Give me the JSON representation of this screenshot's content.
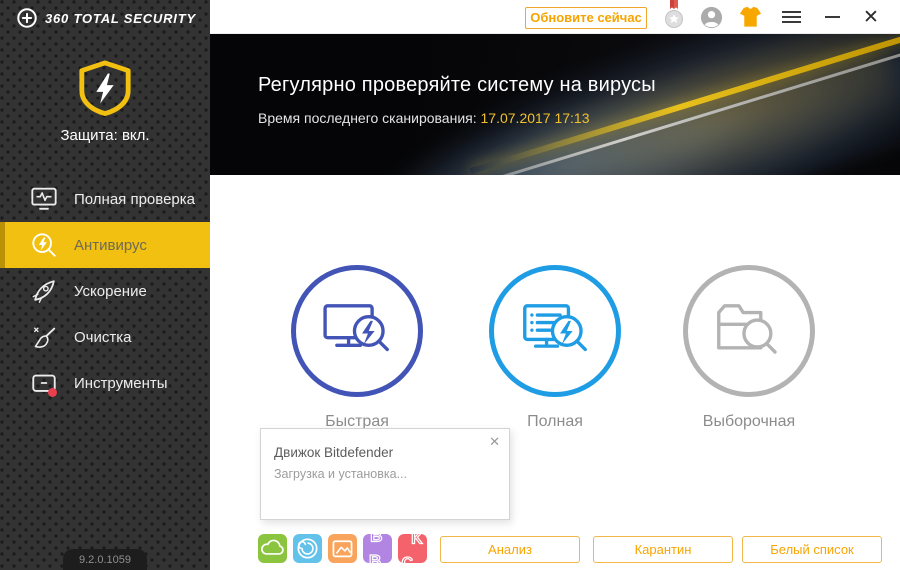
{
  "logo": {
    "text": "360 TOTAL SECURITY"
  },
  "topbar": {
    "update_button": "Обновите сейчас",
    "close_glyph": "✕"
  },
  "sidebar": {
    "protection_status": "Защита: вкл.",
    "items": [
      "Полная проверка",
      "Антивирус",
      "Ускорение",
      "Очистка",
      "Инструменты"
    ],
    "active_item": "Антивирус",
    "version": "9.2.0.1059"
  },
  "banner": {
    "title": "Регулярно проверяйте систему на вирусы",
    "last_scan_label": "Время последнего сканирования:",
    "last_scan_value": "17.07.2017 17:13"
  },
  "scans": [
    "Быстрая",
    "Полная",
    "Выборочная"
  ],
  "popup": {
    "title": "Движок Bitdefender",
    "status": "Загрузка и установка...",
    "close_glyph": "✕"
  },
  "footer": {
    "buttons": [
      "Анализ",
      "Карантин",
      "Белый список"
    ]
  },
  "colors": {
    "accent_yellow": "#f2c011",
    "accent_orange": "#f7a500",
    "scan_quick": "#4254b5",
    "scan_full": "#1e9ce4",
    "scan_custom": "#b3b3b3",
    "last_scan_date": "#f0c12c",
    "notification_red": "#e8414d",
    "app_icon_green": "#8bc53f",
    "app_icon_blue": "#62c2ea",
    "app_icon_orange": "#f9a45c",
    "app_icon_purple": "#b285e2",
    "app_icon_red": "#f4626b"
  }
}
